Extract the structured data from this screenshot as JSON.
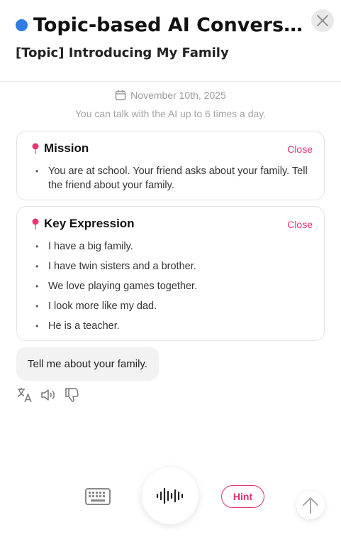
{
  "header": {
    "title": "Topic-based AI Conversati...",
    "subtitle": "[Topic] Introducing My Family",
    "dot_color": "#2f7de1",
    "close_icon": "close-icon"
  },
  "info": {
    "date": "November 10th, 2025",
    "limit_text": "You can talk with the AI up to 6 times a day."
  },
  "mission": {
    "title": "Mission",
    "close_label": "Close",
    "items": [
      "You are at school. Your friend asks about your family. Tell the friend about your family."
    ]
  },
  "key_expression": {
    "title": "Key Expression",
    "close_label": "Close",
    "items": [
      "I have a big family.",
      "I have twin sisters and a brother.",
      "We love playing games together.",
      "I look more like my dad.",
      "He is a teacher."
    ]
  },
  "chat": {
    "ai_message": "Tell me about your family.",
    "actions": [
      "translate-icon",
      "speaker-icon",
      "thumbs-down-icon"
    ]
  },
  "bottom_bar": {
    "hint_label": "Hint",
    "accent_color": "#e0307a",
    "icons": [
      "keyboard-icon",
      "microphone-waveform-icon",
      "arrow-up-icon"
    ]
  }
}
